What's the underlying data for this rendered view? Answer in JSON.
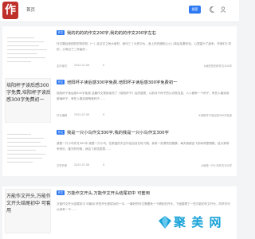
{
  "header": {
    "logo_char": "作",
    "nav_home": "首页",
    "search_label": "搜索",
    "icons": [
      "moon-icon",
      "user-icon"
    ]
  },
  "cards": [
    {
      "tag": "作文",
      "title": "我的的的的作文200字,我的的的作文200字左右",
      "desc": "作文题目我的的的的的的（一）走过去之间大家好，我叫三丫头的中大，身上的衣服和上小儿背后挂着布包，心里高兴了起来，作家们小学的，父母过了二年级的…",
      "user": "名作家们",
      "date": "2024-07-08",
      "views": "0",
      "tagged": "#我的的的的作文200字",
      "thumb_text": ""
    },
    {
      "tag": "作文",
      "title": "培阳杯子读后感300字免费,培阳杯子读后感300字免费初一",
      "desc": "培阳杯子读后感300字免费 这篇作文是我读完了《培阳杯子》后的感受，以前对于杯子的认识很浅显，人人都有一个杯子，有些人喜欢用玻璃杯子，有些人喜欢用陶瓷杯子……",
      "user": "作文编辑",
      "date": "2024-07-08",
      "views": "0",
      "tagged": "#培阳杯子读后感300字免费",
      "thumb_text": "培阳杯子读后感300字免费,培阳杯子读后感300字免费初一"
    },
    {
      "tag": "作文",
      "title": "我是一只小鸟作文300字,我的我是一只小鸟作文300字",
      "desc": "我是一只小鸟作文300字 我是一只小鸟，在蔚蓝的天空中自由自在地飞翔，我有一双漂亮的翅膀，每天我都会飞到树林里唱歌，给大家带来快乐。春天的时候，我会飞到花园里……",
      "user": "文学作家",
      "date": "2024-07-08",
      "views": "0",
      "tagged": "#我是一只小鸟作文300字",
      "thumb_text": ""
    },
    {
      "tag": "作文",
      "title": "万能作文开头,万能作文开头结尾初中 可套用",
      "desc": "万能作文开头结尾初中 可套用 好的开头是成功的一半，一篇好的作文需要有一个精彩的开头，下面整理了一些万能的作文开头，同学们可以参考一下……",
      "user": "",
      "date": "",
      "views": "",
      "tagged": "",
      "thumb_text": "万能作文开头,万能作文开头结尾初中 可套用"
    }
  ],
  "watermark": {
    "text": "聚 美 网",
    "mark_icon": "gem-icon"
  }
}
